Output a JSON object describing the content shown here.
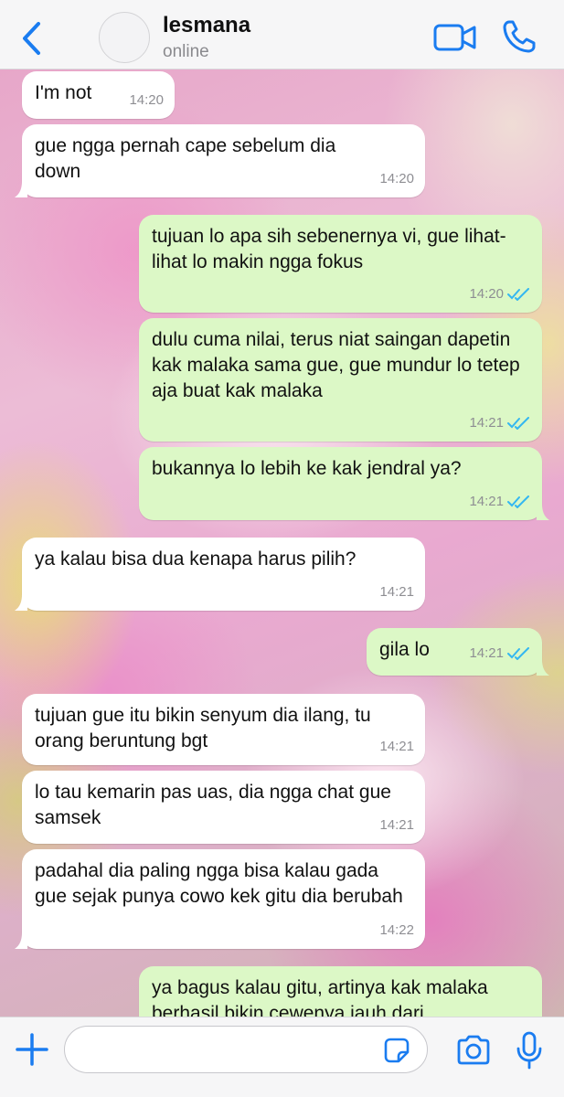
{
  "header": {
    "contact_name": "lesmana",
    "status": "online",
    "back_icon": "chevron-left-icon",
    "video_icon": "video-call-icon",
    "call_icon": "phone-icon",
    "accent_color": "#1a7cf0"
  },
  "messages": [
    {
      "dir": "in",
      "text": "I'm not",
      "time": "14:20"
    },
    {
      "dir": "in",
      "text": "gue ngga pernah cape sebelum dia down",
      "time": "14:20"
    },
    {
      "dir": "out",
      "text": "tujuan lo apa sih sebenernya vi, gue lihat-lihat lo makin ngga fokus",
      "time": "14:20",
      "status": "read"
    },
    {
      "dir": "out",
      "text": "dulu cuma nilai, terus niat saingan dapetin kak malaka sama gue, gue mundur lo tetep aja buat kak malaka",
      "time": "14:21",
      "status": "read"
    },
    {
      "dir": "out",
      "text": "bukannya lo lebih ke kak jendral ya?",
      "time": "14:21",
      "status": "read"
    },
    {
      "dir": "in",
      "text": "ya kalau bisa dua kenapa harus pilih?",
      "time": "14:21"
    },
    {
      "dir": "out",
      "text": "gila lo",
      "time": "14:21",
      "status": "read"
    },
    {
      "dir": "in",
      "text": "tujuan gue itu bikin senyum dia ilang, tu orang beruntung bgt",
      "time": "14:21"
    },
    {
      "dir": "in",
      "text": "lo tau kemarin pas uas, dia ngga chat gue samsek",
      "time": "14:21"
    },
    {
      "dir": "in",
      "text": "padahal dia paling ngga bisa kalau gada gue sejak punya cowo kek gitu dia berubah",
      "time": "14:22"
    },
    {
      "dir": "out",
      "text": "ya bagus kalau gitu, artinya kak malaka berhasil bikin cewenya jauh dari",
      "time": "",
      "status": ""
    }
  ],
  "composer": {
    "placeholder": "",
    "plus_icon": "plus-icon",
    "sticker_icon": "sticker-icon",
    "camera_icon": "camera-icon",
    "mic_icon": "microphone-icon"
  },
  "colors": {
    "incoming_bubble": "#ffffff",
    "outgoing_bubble": "#dcf8c6",
    "read_ticks": "#34b7f1"
  }
}
